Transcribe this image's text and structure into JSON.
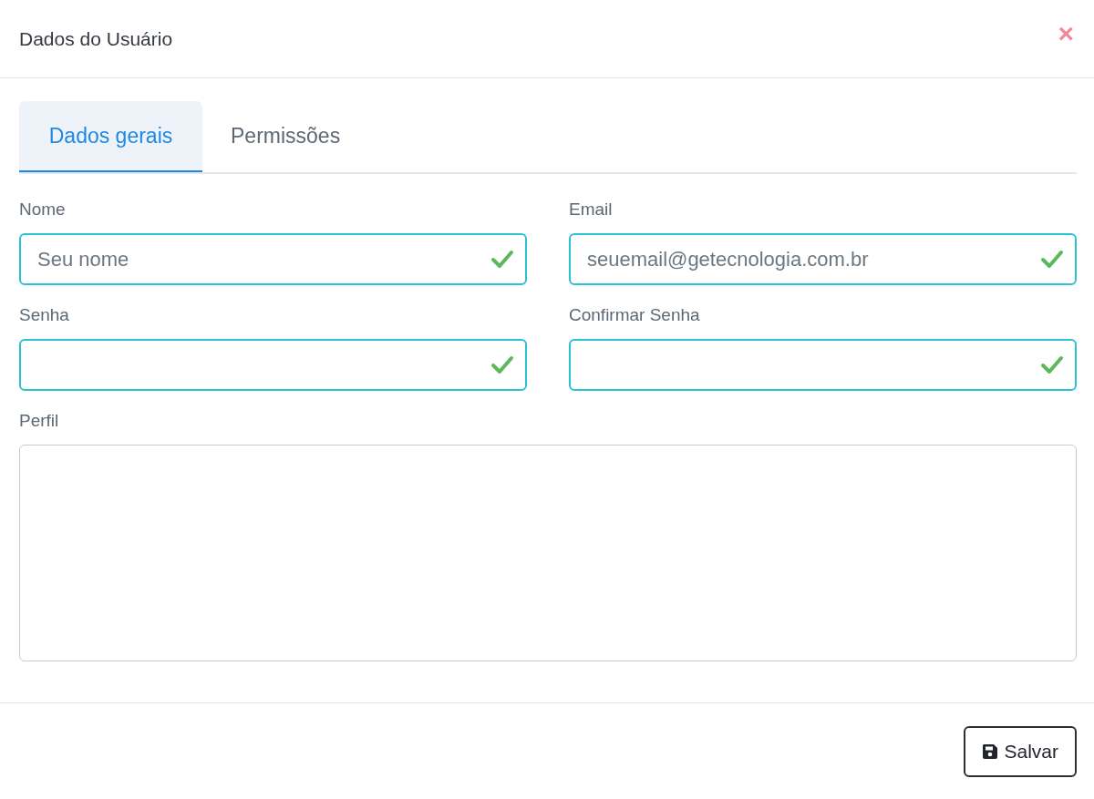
{
  "modal": {
    "title": "Dados do Usuário",
    "close_label": "×"
  },
  "tabs": [
    {
      "label": "Dados gerais",
      "selected": true
    },
    {
      "label": "Permissões",
      "selected": false
    }
  ],
  "fields": [
    {
      "kind": "input",
      "label": "Nome",
      "placeholder": "Seu nome",
      "valid": true
    },
    {
      "kind": "input",
      "label": "Email",
      "placeholder": "seuemail@getecnologia.com.br",
      "valid": true
    },
    {
      "kind": "input",
      "label": "Senha",
      "valid": true
    },
    {
      "kind": "input",
      "label": "Confirmar Senha",
      "valid": true
    },
    {
      "kind": "textarea",
      "label": "Perfil",
      "valid": false
    }
  ],
  "footer": {
    "save_button": "Salvar"
  }
}
